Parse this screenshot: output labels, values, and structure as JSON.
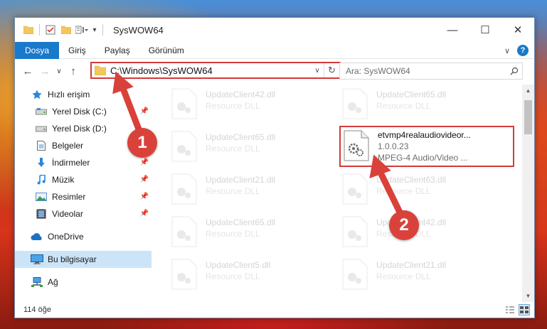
{
  "window": {
    "title": "SysWOW64",
    "controls": {
      "minimize": "—",
      "maximize": "☐",
      "close": "✕"
    }
  },
  "ribbon": {
    "tabs": [
      "Dosya",
      "Giriş",
      "Paylaş",
      "Görünüm"
    ],
    "expand_icon": "chevron-down-icon",
    "help_label": "?"
  },
  "nav": {
    "back": "←",
    "forward": "→",
    "recent": "∨",
    "up": "↑",
    "address": "C:\\Windows\\SysWOW64",
    "address_dropdown": "∨",
    "refresh": "↻",
    "search_placeholder": "Ara: SysWOW64"
  },
  "sidebar": {
    "items": [
      {
        "label": "Hızlı erişim",
        "icon": "star-icon",
        "pinned": false
      },
      {
        "label": "Yerel Disk (C:)",
        "icon": "drive-icon",
        "pinned": true
      },
      {
        "label": "Yerel Disk (D:)",
        "icon": "drive-icon",
        "pinned": false
      },
      {
        "label": "Belgeler",
        "icon": "documents-icon",
        "pinned": true
      },
      {
        "label": "İndirmeler",
        "icon": "download-icon",
        "pinned": true
      },
      {
        "label": "Müzik",
        "icon": "music-icon",
        "pinned": true
      },
      {
        "label": "Resimler",
        "icon": "pictures-icon",
        "pinned": true
      },
      {
        "label": "Videolar",
        "icon": "video-icon",
        "pinned": true
      },
      {
        "label": "OneDrive",
        "icon": "cloud-icon",
        "pinned": false
      },
      {
        "label": "Bu bilgisayar",
        "icon": "computer-icon",
        "pinned": false,
        "selected": true
      },
      {
        "label": "Ağ",
        "icon": "network-icon",
        "pinned": false
      }
    ],
    "pin_glyph": "📌"
  },
  "files": [
    {
      "name": "UpdateClient42.dll",
      "sub": "Resource DLL",
      "faded": true
    },
    {
      "name": "UpdateClient65.dll",
      "sub": "Resource DLL",
      "faded": true
    },
    {
      "name": "UpdateClient65.dll",
      "sub": "Resource DLL",
      "faded": true
    },
    {
      "name": "etvmp4realaudiovideor...",
      "version": "1.0.0.23",
      "sub": "MPEG-4 Audio/Video ...",
      "faded": false,
      "highlighted": true
    },
    {
      "name": "UpdateClient21.dll",
      "sub": "Resource DLL",
      "faded": true
    },
    {
      "name": "UpdateClient63.dll",
      "sub": "Resource DLL",
      "faded": true
    },
    {
      "name": "UpdateClient65.dll",
      "sub": "Resource DLL",
      "faded": true
    },
    {
      "name": "UpdateClient42.dll",
      "sub": "Resource DLL",
      "faded": true
    },
    {
      "name": "UpdateClient5.dll",
      "sub": "Resource DLL",
      "faded": true
    },
    {
      "name": "UpdateClient21.dll",
      "sub": "Resource DLL",
      "faded": true
    }
  ],
  "status": {
    "count": "114 öğe"
  },
  "annotations": {
    "step1": "1",
    "step2": "2",
    "color": "#d9423b"
  },
  "colors": {
    "accent": "#1979ca",
    "highlight": "#d33a3a",
    "selection": "#cce4f7"
  }
}
